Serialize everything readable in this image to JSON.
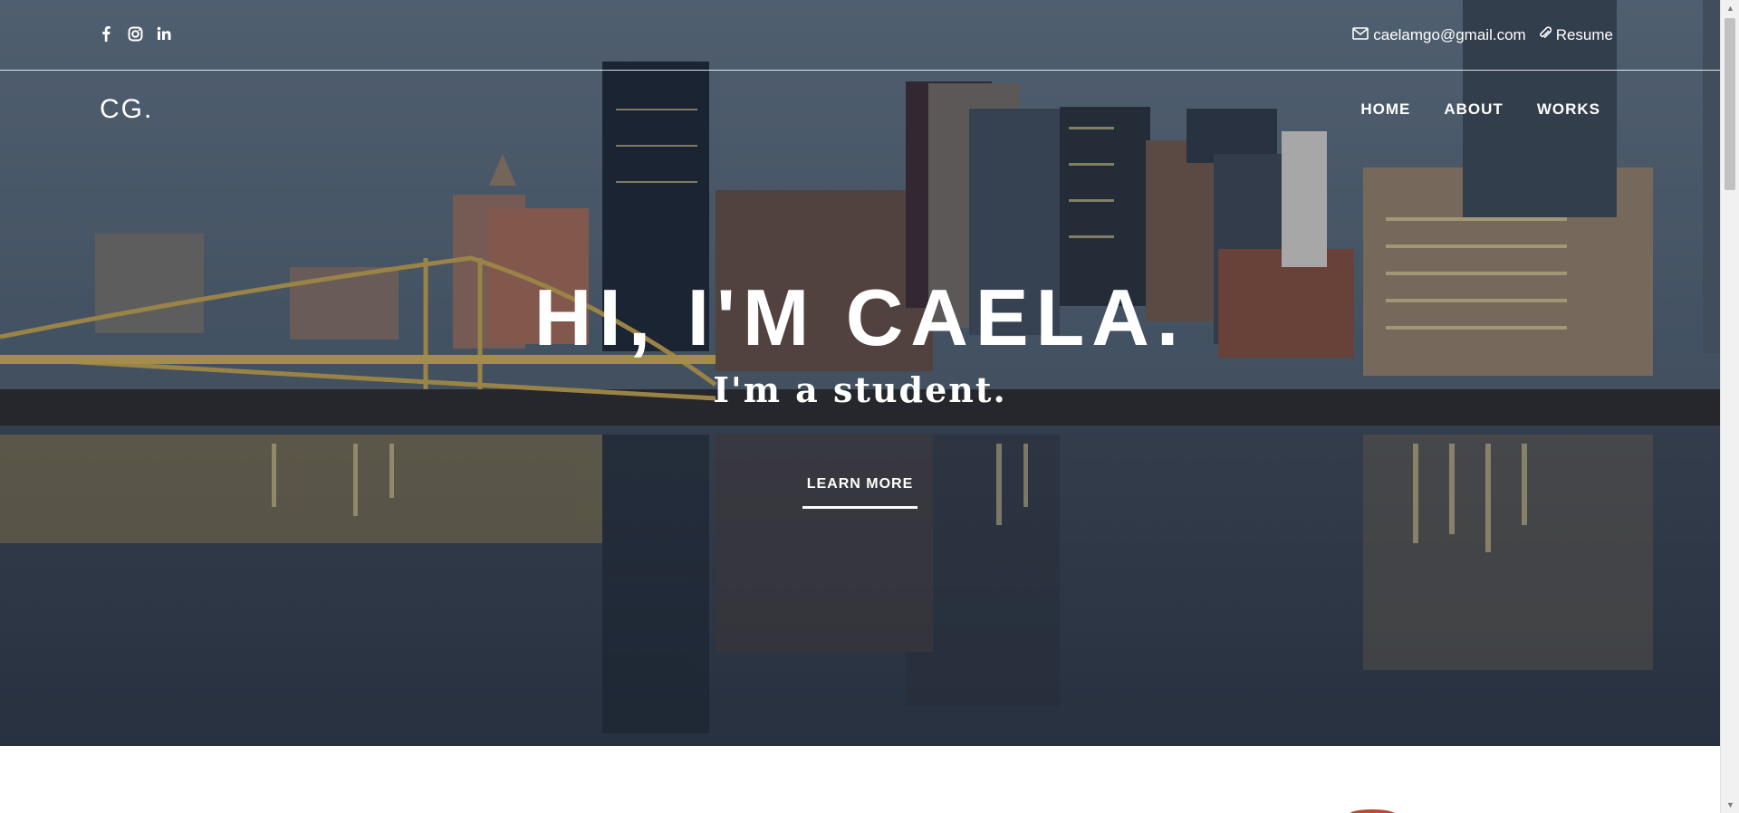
{
  "social": {
    "icons": [
      "facebook-icon",
      "instagram-icon",
      "linkedin-icon"
    ]
  },
  "contact": {
    "email": "caelamgo@gmail.com",
    "resume": "Resume",
    "email_icon": "envelope-icon",
    "resume_icon": "paperclip-icon"
  },
  "brand": {
    "logo": "CG."
  },
  "nav": {
    "home": "HOME",
    "about": "ABOUT",
    "works": "WORKS"
  },
  "hero": {
    "title": "HI, I'M CAELA.",
    "subtitle": "I'm a student.",
    "cta": "LEARN MORE"
  },
  "colors": {
    "text": "#ffffff",
    "hero_overlay": "#3c4856",
    "accent_peek": "#b84a36"
  }
}
